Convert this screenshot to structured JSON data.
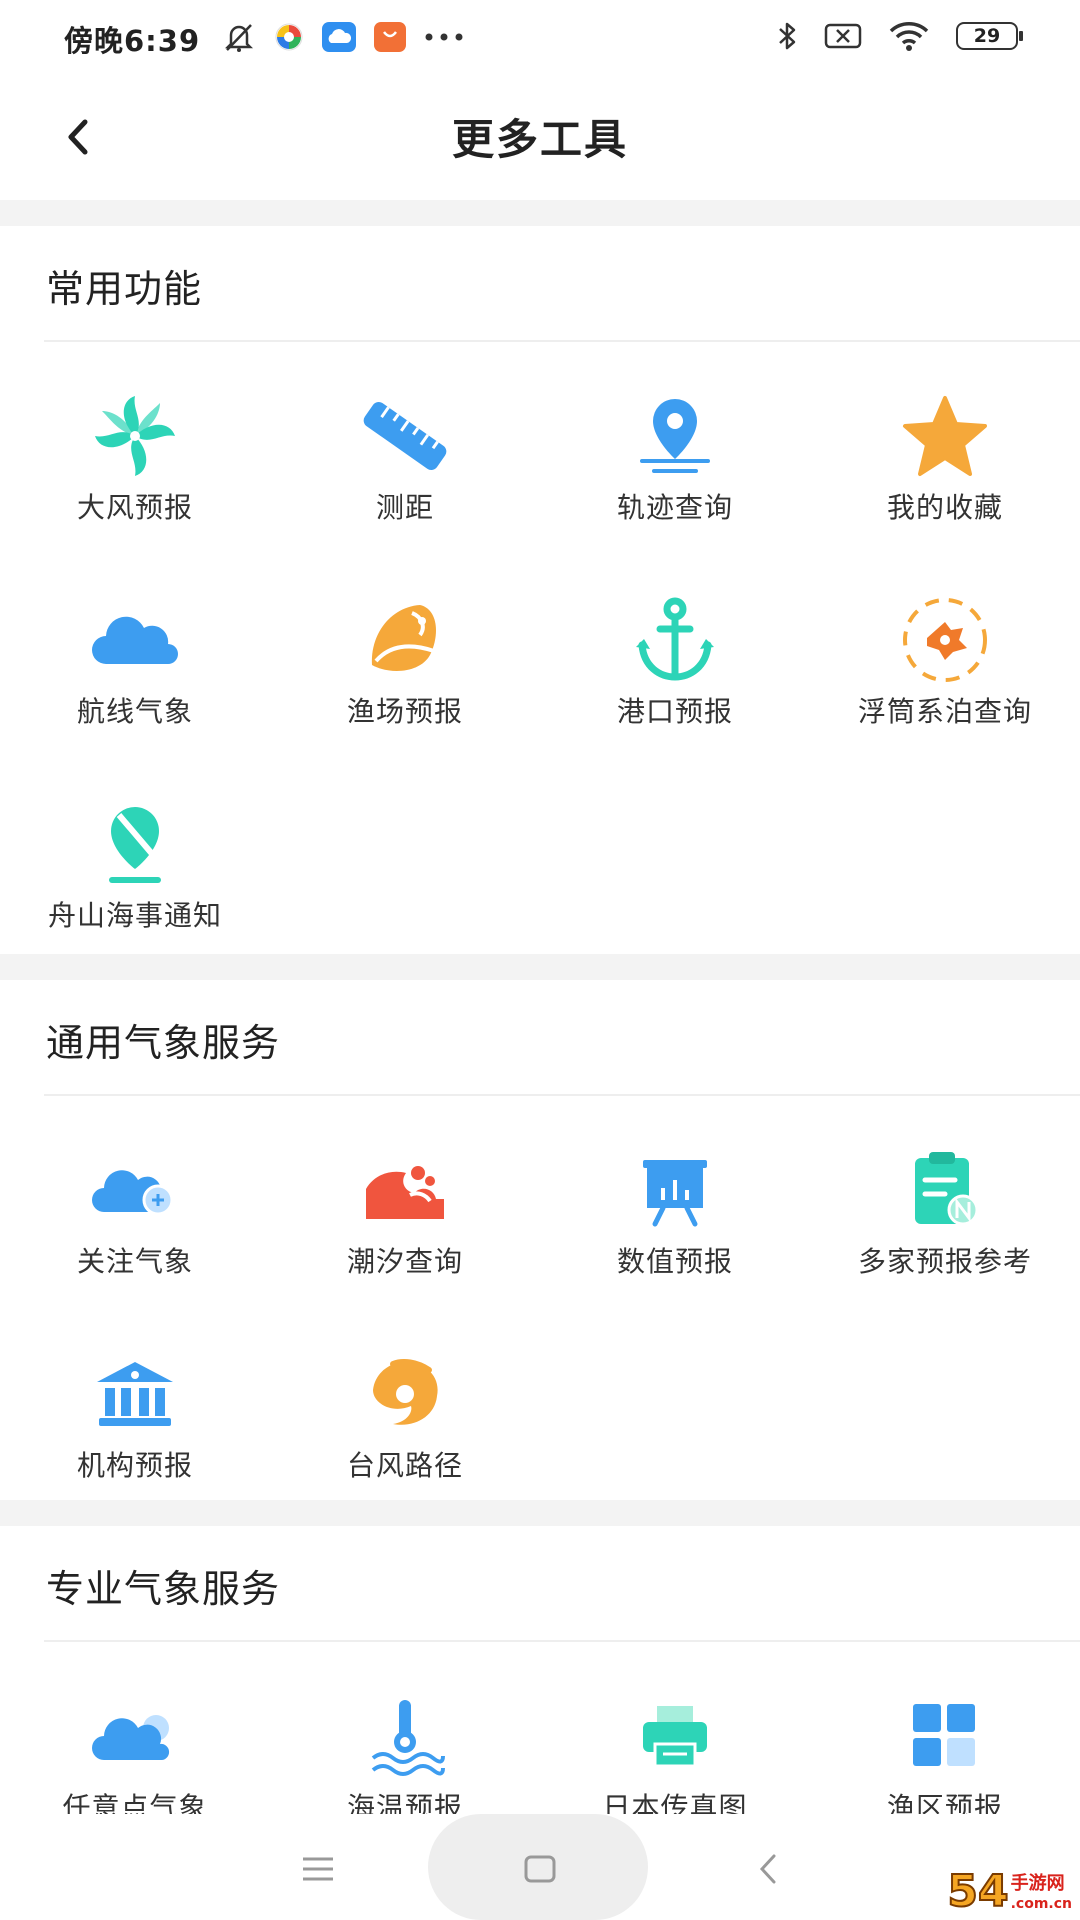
{
  "status_bar": {
    "time": "傍晚6:39",
    "left_icons": [
      "mute-bell-icon",
      "app-colorful-icon",
      "cloud-app-icon",
      "shop-app-icon",
      "more-dots-icon"
    ],
    "right_icons": [
      "bluetooth-icon",
      "sim-off-icon",
      "wifi-icon"
    ],
    "battery": "29"
  },
  "header": {
    "title": "更多工具"
  },
  "sections": [
    {
      "title": "常用功能",
      "items": [
        {
          "label": "大风预报",
          "icon": "windmill-icon"
        },
        {
          "label": "测距",
          "icon": "ruler-icon"
        },
        {
          "label": "轨迹查询",
          "icon": "location-pin-icon"
        },
        {
          "label": "我的收藏",
          "icon": "star-icon"
        },
        {
          "label": "航线气象",
          "icon": "cloud-icon"
        },
        {
          "label": "渔场预报",
          "icon": "fishing-ground-icon"
        },
        {
          "label": "港口预报",
          "icon": "anchor-icon"
        },
        {
          "label": "浮筒系泊查询",
          "icon": "buoy-icon"
        },
        {
          "label": "舟山海事通知",
          "icon": "notice-pin-icon"
        }
      ]
    },
    {
      "title": "通用气象服务",
      "items": [
        {
          "label": "关注气象",
          "icon": "cloud-add-icon"
        },
        {
          "label": "潮汐查询",
          "icon": "wave-icon"
        },
        {
          "label": "数值预报",
          "icon": "chart-board-icon"
        },
        {
          "label": "多家预报参考",
          "icon": "clipboard-icon"
        },
        {
          "label": "机构预报",
          "icon": "institution-icon"
        },
        {
          "label": "台风路径",
          "icon": "typhoon-icon"
        }
      ]
    },
    {
      "title": "专业气象服务",
      "items": [
        {
          "label": "任意点气象",
          "icon": "cloud-sun-icon"
        },
        {
          "label": "海温预报",
          "icon": "sea-temperature-icon"
        },
        {
          "label": "日本传真图",
          "icon": "fax-icon"
        },
        {
          "label": "渔区预报",
          "icon": "grid-blocks-icon"
        }
      ]
    }
  ],
  "colors": {
    "teal": "#2dd4b7",
    "blue": "#3d9df0",
    "orange": "#f5a83a",
    "red": "#f0553e"
  },
  "nav_bar": {
    "buttons": [
      "menu-icon",
      "home-square-icon",
      "back-triangle-icon"
    ]
  },
  "watermark": {
    "number": "54",
    "text": "手游网",
    "domain": ".com.cn"
  }
}
